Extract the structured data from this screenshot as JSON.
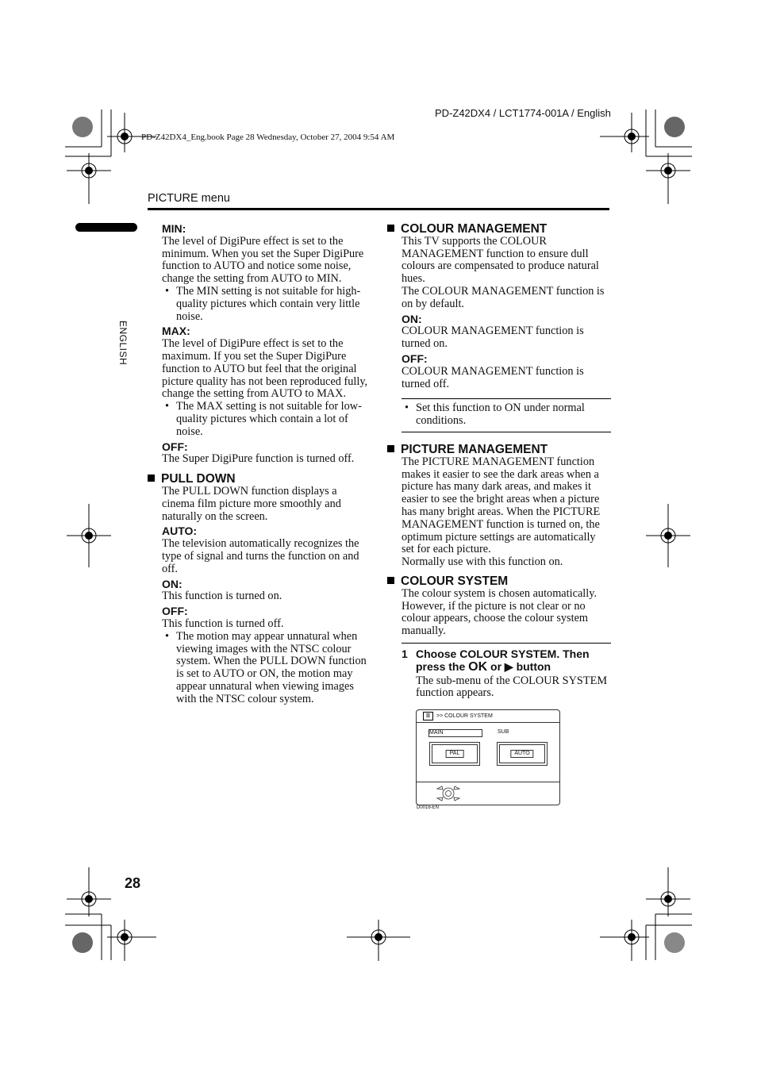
{
  "header": {
    "doc_id": "PD-Z42DX4 / LCT1774-001A / English",
    "book_line": "PD-Z42DX4_Eng.book  Page 28  Wednesday, October 27, 2004  9:54 AM",
    "section_title": "PICTURE menu",
    "side_label": "ENGLISH"
  },
  "left_column": {
    "min_label": "MIN:",
    "min_text": "The level of DigiPure effect is set to the minimum. When you set the Super DigiPure function to AUTO and notice some noise, change the setting from AUTO to MIN.",
    "min_bullet": "The MIN setting is not suitable for high-quality pictures which contain very little noise.",
    "max_label": "MAX:",
    "max_text": "The level of DigiPure effect is set to the maximum. If you set the Super DigiPure function to AUTO but feel that the original picture quality has not been reproduced fully, change the setting from AUTO to MAX.",
    "max_bullet": "The MAX setting is not suitable for low-quality pictures which contain a lot of noise.",
    "off_label": "OFF:",
    "off_text": "The Super DigiPure function is turned off.",
    "pulldown_heading": "PULL DOWN",
    "pulldown_text": "The PULL DOWN function displays a cinema film picture more smoothly and naturally on the screen.",
    "auto_label": "AUTO:",
    "auto_text": "The television automatically recognizes the type of signal and turns the function on and off.",
    "on_label": "ON:",
    "on_text": "This function is turned on.",
    "off2_label": "OFF:",
    "off2_text": "This function is turned off.",
    "pulldown_bullet": "The motion may appear unnatural when viewing images with the NTSC colour system. When the PULL DOWN function is set to AUTO or ON, the motion may appear unnatural when viewing images with the NTSC colour system."
  },
  "right_column": {
    "cm_heading": "COLOUR MANAGEMENT",
    "cm_text1": "This TV supports the COLOUR MANAGEMENT function to ensure dull colours are compensated to produce natural hues.",
    "cm_text2": "The COLOUR MANAGEMENT function is on by default.",
    "cm_on_label": "ON:",
    "cm_on_text": "COLOUR MANAGEMENT function is turned on.",
    "cm_off_label": "OFF:",
    "cm_off_text": "COLOUR MANAGEMENT function is turned off.",
    "cm_note": "Set this function to ON under normal conditions.",
    "pm_heading": "PICTURE MANAGEMENT",
    "pm_text1": "The PICTURE MANAGEMENT function makes it easier to see the dark areas when a picture has many dark areas, and makes it easier to see the bright areas when a picture has many bright areas. When the PICTURE MANAGEMENT function is turned on, the optimum picture settings are automatically set for each picture.",
    "pm_text2": "Normally use with this function on.",
    "cs_heading": "COLOUR SYSTEM",
    "cs_text": "The colour system is chosen automatically. However, if the picture is not clear or no colour appears, choose the colour system manually.",
    "step_number": "1",
    "step_title_a": "Choose COLOUR SYSTEM. Then press the ",
    "step_ok": "OK",
    "step_title_b": " or ▶ button",
    "step_text": "The sub-menu of the COLOUR SYSTEM function appears."
  },
  "osd": {
    "menu_icon": "tv-menu-icon",
    "title": ">> COLOUR SYSTEM",
    "main_label": "MAIN",
    "sub_label": "SUB",
    "main_value": "PAL",
    "sub_value": "AUTO",
    "figure_code": "D0016-EN"
  },
  "footer": {
    "page_number": "28"
  }
}
